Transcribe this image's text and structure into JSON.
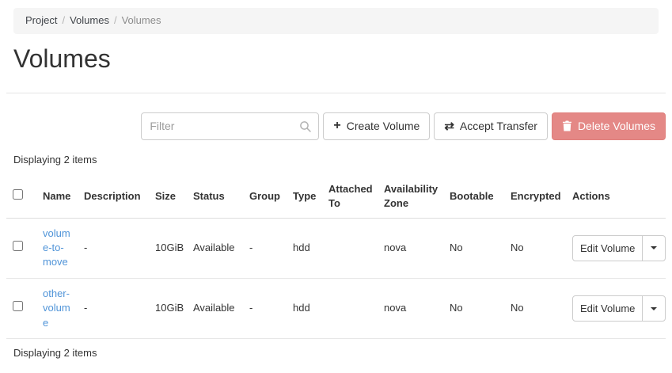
{
  "breadcrumb": {
    "separator": "/",
    "items": [
      "Project",
      "Volumes",
      "Volumes"
    ]
  },
  "page": {
    "title": "Volumes"
  },
  "toolbar": {
    "filter_placeholder": "Filter",
    "create_volume_label": "Create Volume",
    "accept_transfer_label": "Accept Transfer",
    "delete_volumes_label": "Delete Volumes"
  },
  "icons": {
    "plus": "+",
    "transfer_arrows": "⇄",
    "search": "magnifier",
    "trash": "trash-can",
    "caret": "caret-down"
  },
  "summary": {
    "top": "Displaying 2 items",
    "bottom": "Displaying 2 items"
  },
  "table": {
    "columns": [
      "Name",
      "Description",
      "Size",
      "Status",
      "Group",
      "Type",
      "Attached To",
      "Availability Zone",
      "Bootable",
      "Encrypted",
      "Actions"
    ],
    "rows": [
      {
        "name": "volume-to-move",
        "description": "-",
        "size": "10GiB",
        "status": "Available",
        "group": "-",
        "type": "hdd",
        "attached_to": "",
        "availability_zone": "nova",
        "bootable": "No",
        "encrypted": "No",
        "action_label": "Edit Volume"
      },
      {
        "name": "other-volume",
        "description": "-",
        "size": "10GiB",
        "status": "Available",
        "group": "-",
        "type": "hdd",
        "attached_to": "",
        "availability_zone": "nova",
        "bootable": "No",
        "encrypted": "No",
        "action_label": "Edit Volume"
      }
    ]
  },
  "colors": {
    "link": "#5094d8",
    "danger_button_bg": "#e48886",
    "breadcrumb_bg": "#f5f5f5"
  }
}
